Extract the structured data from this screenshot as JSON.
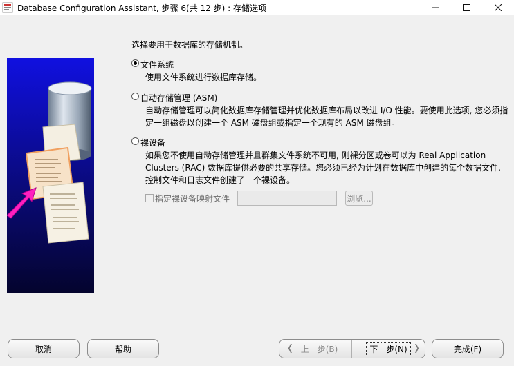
{
  "window": {
    "title": "Database Configuration Assistant, 步骤 6(共 12 步) : 存储选项",
    "minimize_icon": "minimize-icon",
    "maximize_icon": "maximize-icon",
    "close_icon": "close-icon"
  },
  "storage": {
    "prompt": "选择要用于数据库的存储机制。",
    "options": [
      {
        "label": "文件系统",
        "checked": true,
        "desc": [
          "使用文件系统进行数据库存储。"
        ]
      },
      {
        "label": "自动存储管理 (ASM)",
        "checked": false,
        "desc": [
          "自动存储管理可以简化数据库存储管理并优化数据库布局以改进 I/O 性能。要使用此选项, 您必须指",
          "定一组磁盘以创建一个 ASM 磁盘组或指定一个现有的 ASM 磁盘组。"
        ]
      },
      {
        "label": "裸设备",
        "checked": false,
        "desc": [
          "如果您不使用自动存储管理并且群集文件系统不可用, 则裸分区或卷可以为 Real Application",
          "Clusters (RAC) 数据库提供必要的共享存储。您必须已经为计划在数据库中创建的每个数据文件,",
          "控制文件和日志文件创建了一个裸设备。"
        ]
      }
    ],
    "raw_mapping": {
      "checkbox_label": "指定裸设备映射文件",
      "input_value": "",
      "browse_label": "浏览..."
    }
  },
  "buttons": {
    "cancel": "取消",
    "help": "帮助",
    "back": "上一步(B)",
    "next": "下一步(N)",
    "finish": "完成(F)"
  }
}
